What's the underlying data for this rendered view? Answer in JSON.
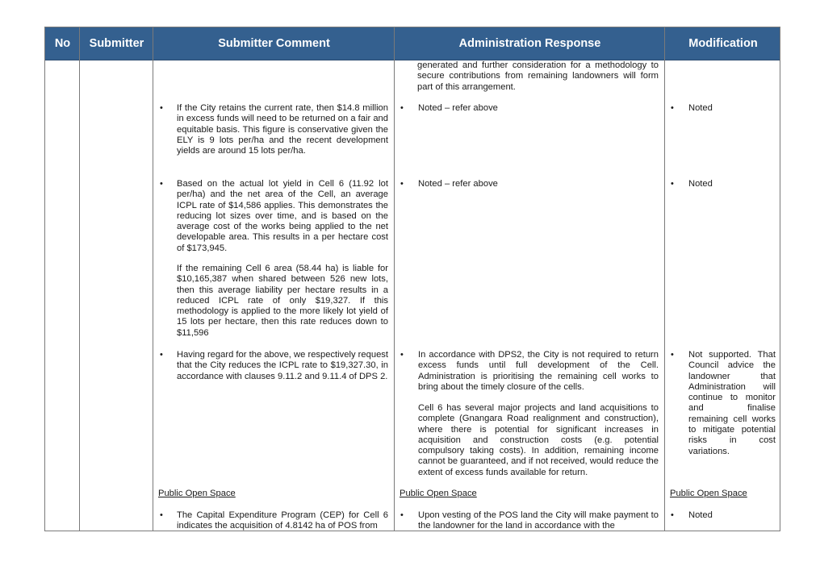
{
  "table": {
    "headers": {
      "no": "No",
      "submitter": "Submitter",
      "comment": "Submitter Comment",
      "response": "Administration Response",
      "modification": "Modification"
    },
    "continued_response": "generated and further consideration for a methodology to secure contributions from remaining landowners will form part of this arrangement.",
    "rows": [
      {
        "comment": "If the City retains the current rate, then $14.8 million in excess funds will need to be returned on a fair and equitable basis. This figure is conservative given the ELY is 9 lots per/ha and the recent development yields are around 15 lots per/ha.",
        "response": "Noted – refer above",
        "modification": "Noted"
      },
      {
        "comment": "Based on the actual lot yield in Cell 6 (11.92 lot per/ha) and the net area of the Cell, an average ICPL rate of $14,586 applies. This demonstrates the reducing lot sizes over time, and is based on the average cost of the works being applied to the net developable area. This results in a per hectare cost of $173,945.",
        "comment_para2": "If the remaining Cell 6 area (58.44 ha) is liable for $10,165,387 when shared between 526 new lots, then this average liability per hectare results in a reduced ICPL rate of only $19,327. If this methodology is applied to the more likely lot yield of 15 lots per hectare, then this rate reduces down to $11,596",
        "response": "Noted – refer above",
        "modification": "Noted"
      },
      {
        "comment": "Having regard for the above, we respectively request that the City reduces the ICPL rate to $19,327.30, in accordance with clauses 9.11.2 and 9.11.4 of DPS 2.",
        "response": "In accordance with DPS2, the City is not required to return excess funds until full development of the Cell. Administration is prioritising the remaining cell works to bring about the timely closure of the cells.",
        "response_para2": "Cell 6 has several major projects and land acquisitions to complete (Gnangara Road realignment and construction), where there is potential for significant increases in acquisition and construction costs (e.g. potential compulsory taking costs). In addition, remaining income cannot be guaranteed, and if not received, would reduce the extent of excess funds available for return.",
        "modification": "Not supported. That Council advice the landowner that Administration will continue to monitor and finalise remaining cell works to mitigate potential risks in cost variations."
      }
    ],
    "section": {
      "heading_comment": "Public Open Space",
      "heading_response": "Public Open Space",
      "heading_modification": "Public Open Space",
      "comment": "The Capital Expenditure Program (CEP) for Cell 6 indicates the acquisition of 4.8142 ha of POS from",
      "response": "Upon vesting of the POS land the City will make payment to the landowner for the land in accordance with the",
      "modification": "Noted"
    },
    "bullet_glyph": "•"
  }
}
